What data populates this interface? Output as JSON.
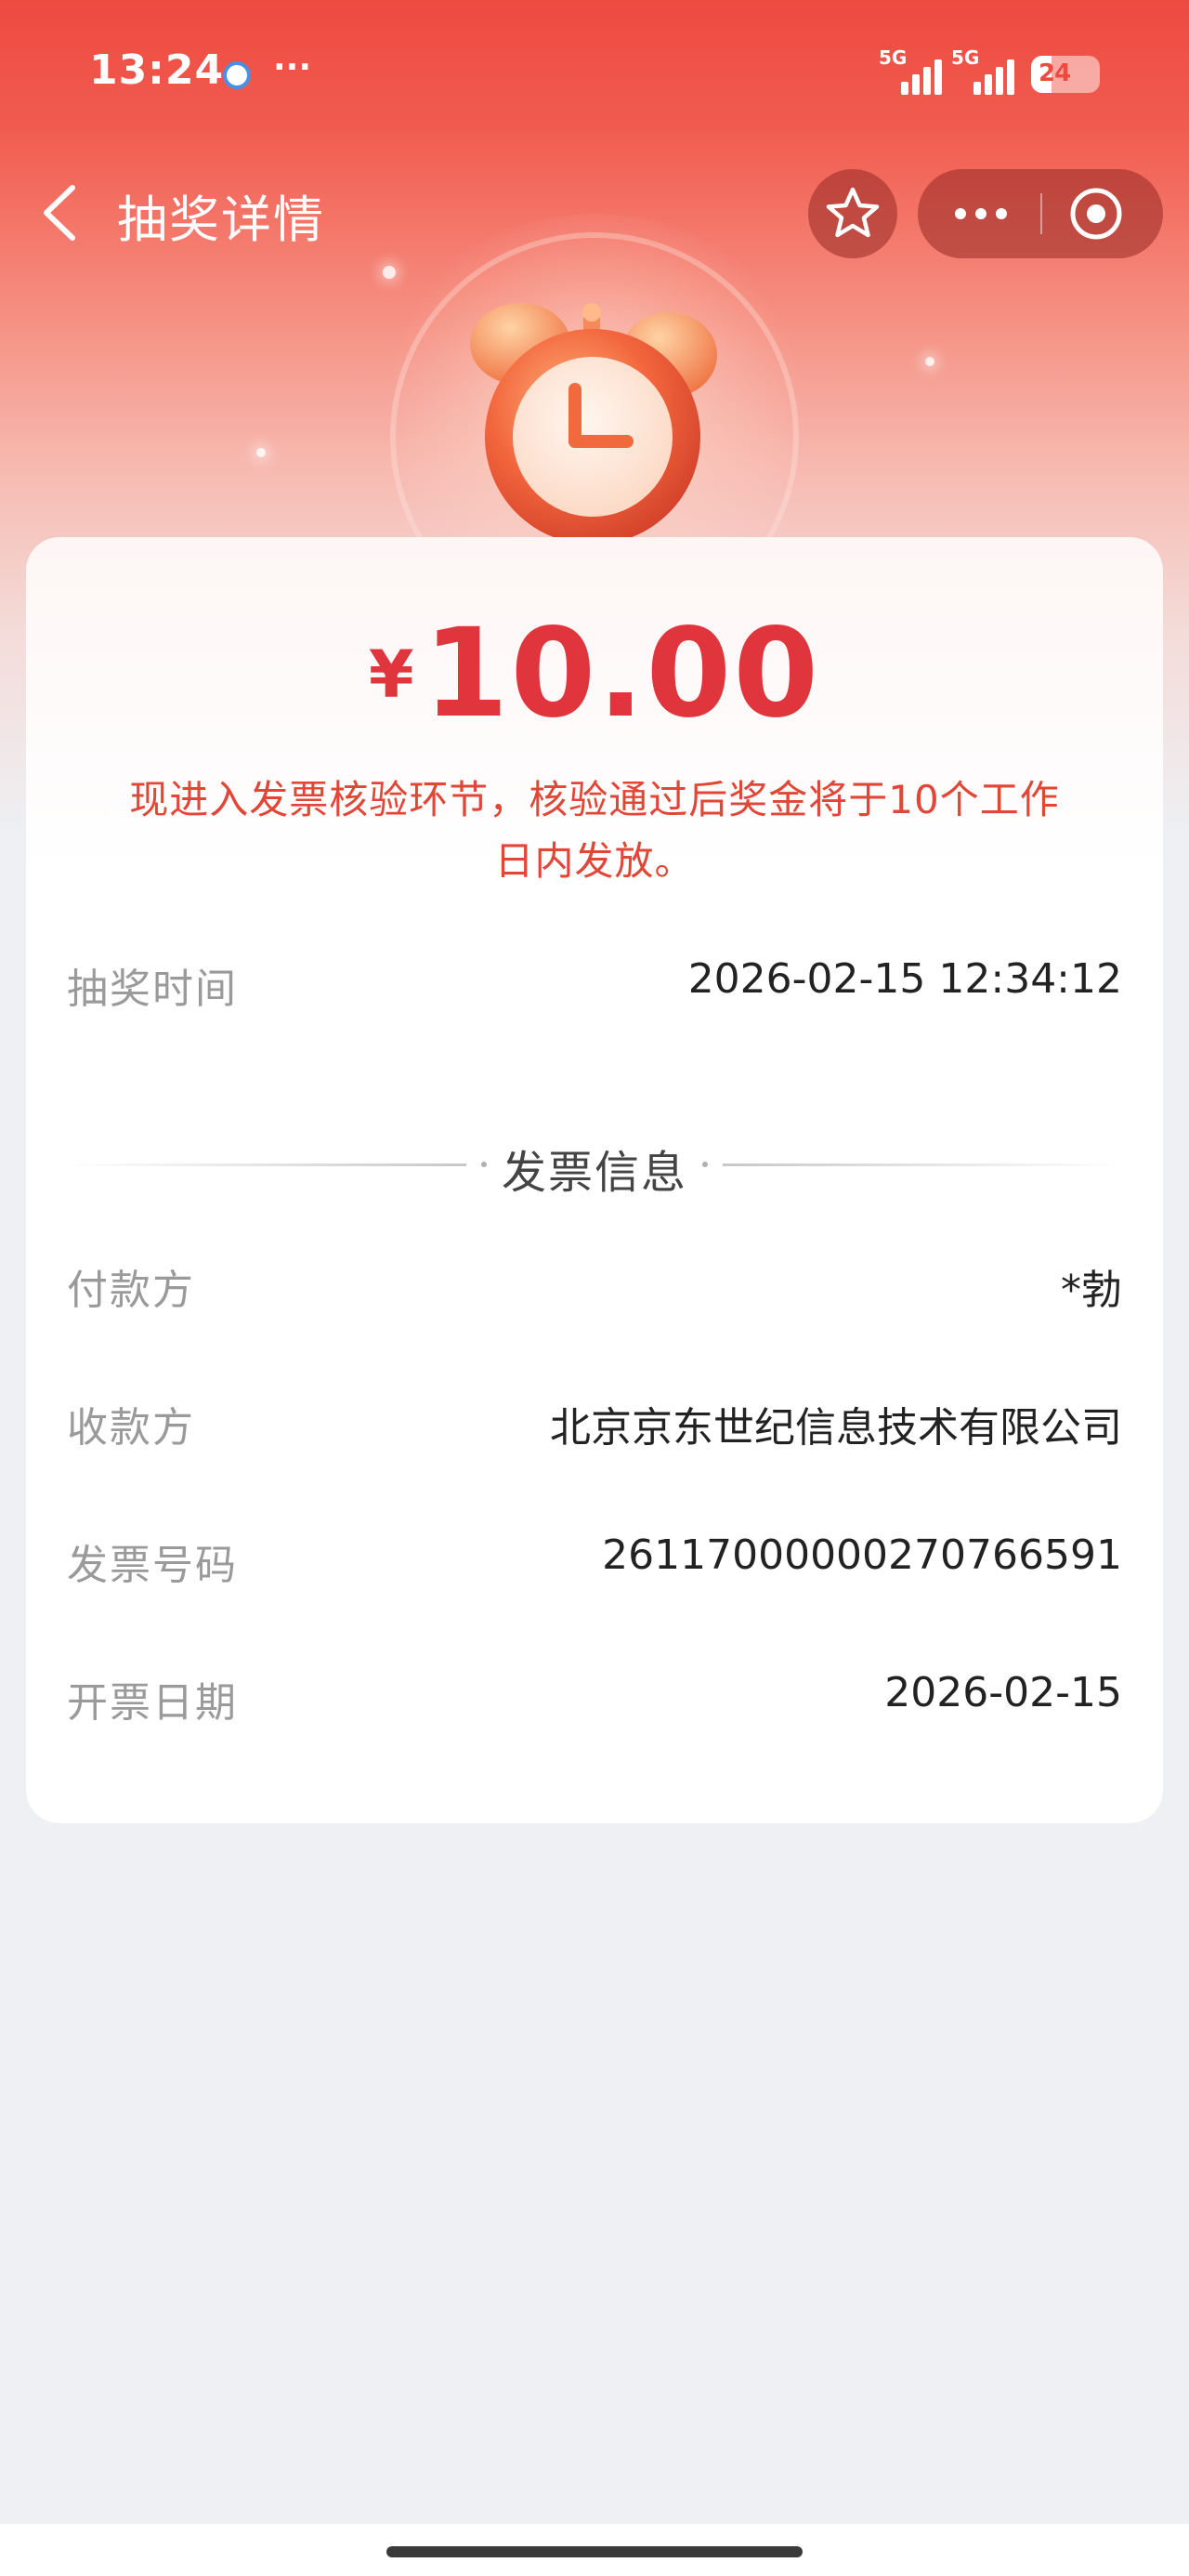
{
  "status_bar": {
    "time": "13:24",
    "more": "···",
    "signal_1": "5G",
    "signal_2": "5G",
    "battery": "24"
  },
  "nav": {
    "title": "抽奖详情"
  },
  "prize": {
    "currency": "¥",
    "amount": "10.00",
    "notice": "现进入发票核验环节，核验通过后奖金将于10个工作日内发放。"
  },
  "draw_time": {
    "label": "抽奖时间",
    "value": "2026-02-15 12:34:12"
  },
  "invoice": {
    "section_title": "发票信息",
    "payer": {
      "label": "付款方",
      "value": "*勃"
    },
    "payee": {
      "label": "收款方",
      "value": "北京京东世纪信息技术有限公司"
    },
    "number": {
      "label": "发票号码",
      "value": "26117000000270766591"
    },
    "date": {
      "label": "开票日期",
      "value": "2026-02-15"
    }
  },
  "colors": {
    "accent_red": "#e0353c",
    "header_red": "#ee4a40",
    "page_bg": "#eef0f4"
  }
}
